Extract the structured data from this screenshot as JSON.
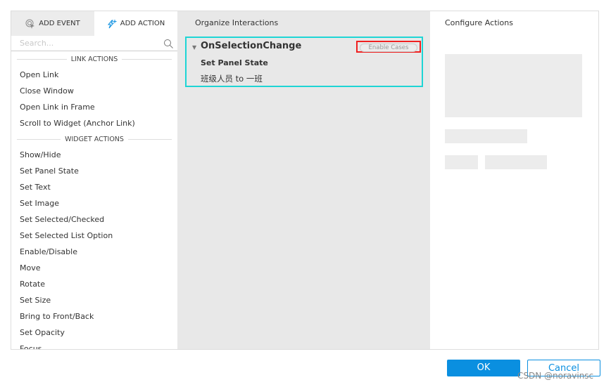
{
  "left": {
    "tabs": [
      {
        "label": "ADD EVENT",
        "icon": "cursor-click-icon"
      },
      {
        "label": "ADD ACTION",
        "icon": "lightning-plus-icon"
      }
    ],
    "search_placeholder": "Search...",
    "sections": [
      {
        "title": "LINK ACTIONS",
        "items": [
          "Open Link",
          "Close Window",
          "Open Link in Frame",
          "Scroll to Widget (Anchor Link)"
        ]
      },
      {
        "title": "WIDGET ACTIONS",
        "items": [
          "Show/Hide",
          "Set Panel State",
          "Set Text",
          "Set Image",
          "Set Selected/Checked",
          "Set Selected List Option",
          "Enable/Disable",
          "Move",
          "Rotate",
          "Set Size",
          "Bring to Front/Back",
          "Set Opacity",
          "Focus"
        ]
      }
    ]
  },
  "middle": {
    "title": "Organize Interactions",
    "event": "OnSelectionChange",
    "enable_cases": "Enable Cases",
    "action": "Set Panel State",
    "target": "班级人员 to 一班"
  },
  "right": {
    "title": "Configure Actions"
  },
  "footer": {
    "ok": "OK",
    "cancel": "Cancel",
    "watermark": "CSDN @noravinsc"
  },
  "colors": {
    "accent": "#0a8fe0",
    "highlight_box": "#1ed5d5",
    "annotation": "#f02020"
  }
}
